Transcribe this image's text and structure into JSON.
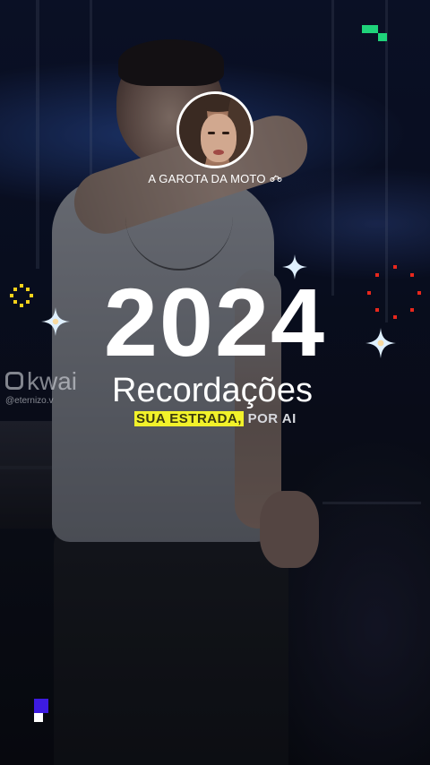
{
  "profile": {
    "name": "A GAROTA DA MOTO",
    "name_icon": "motorcycle-icon"
  },
  "headline": {
    "year": "2024",
    "subtitle": "Recordações"
  },
  "caption": {
    "highlighted": "SUA ESTRADA,",
    "rest": " POR AI"
  },
  "watermark": {
    "brand": "kwai",
    "user": "@eternizo.v"
  },
  "colors": {
    "caption_highlight": "#f2f22a",
    "corner_pixel_top_right": "#1fd37a",
    "corner_pixel_bottom_left": "#3d1be0",
    "sparkle": "#dff0ff",
    "firework_yellow": "#f7d21a",
    "firework_red": "#e8271c"
  }
}
